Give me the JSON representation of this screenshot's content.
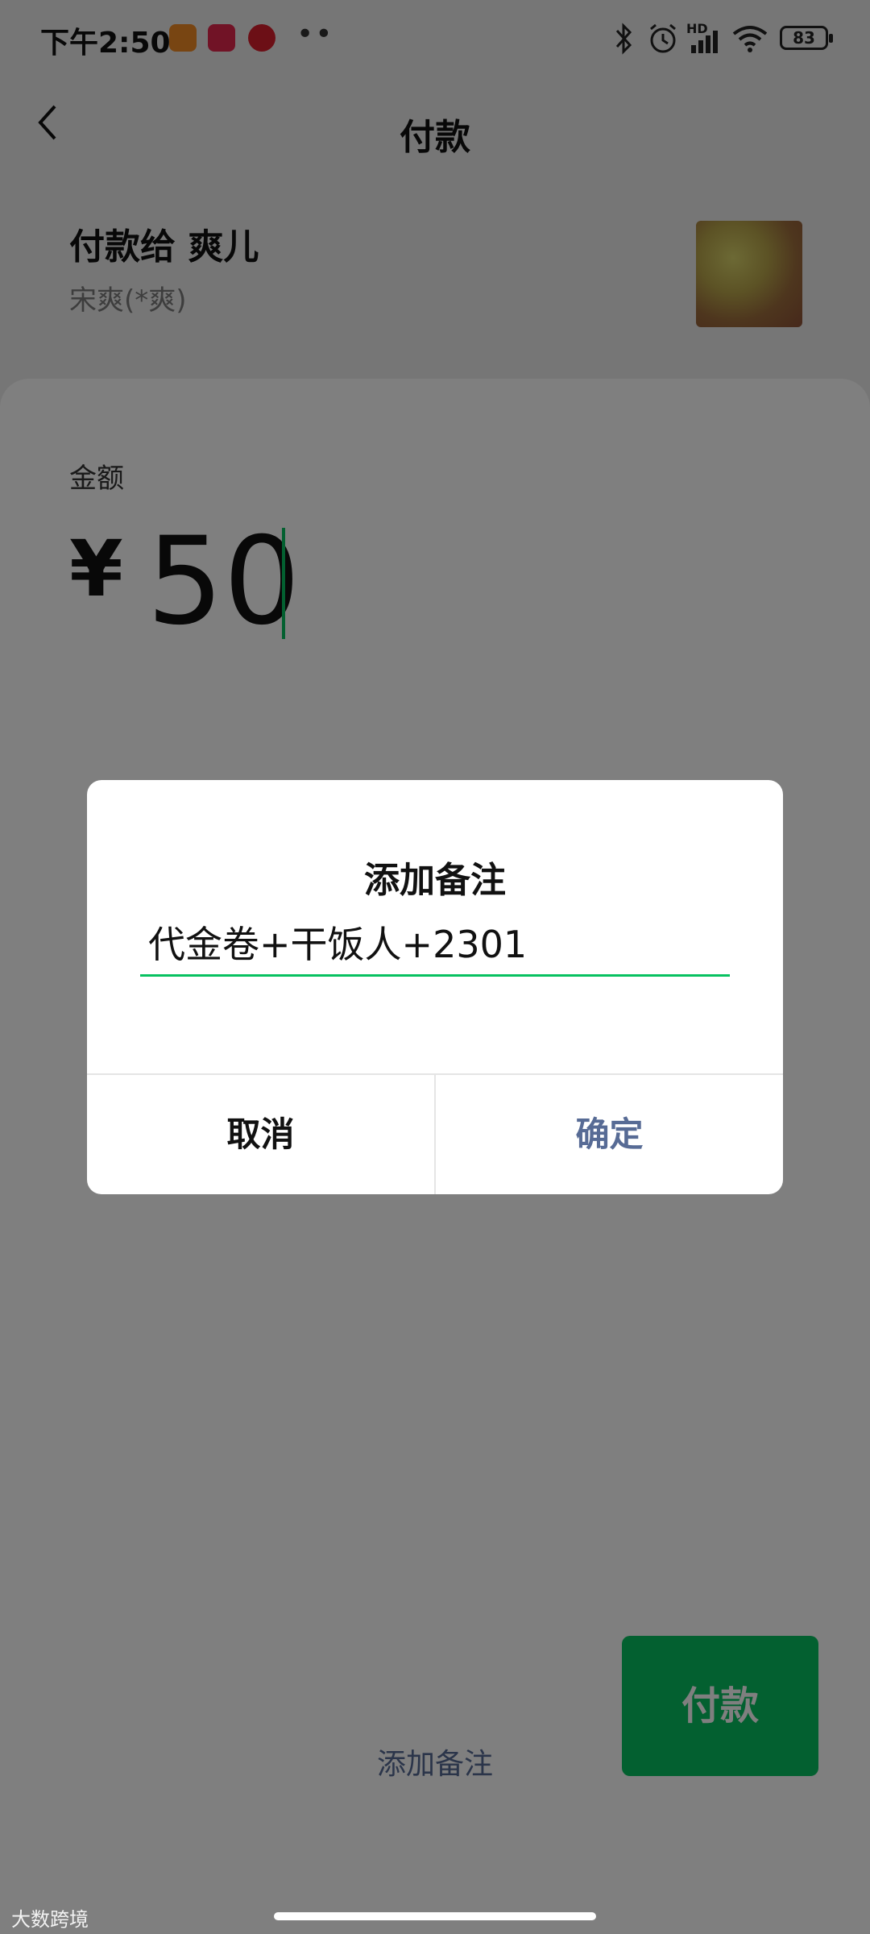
{
  "status_bar": {
    "time": "下午2:50",
    "dots": "••",
    "battery": "83",
    "hd": "HD"
  },
  "header": {
    "title": "付款"
  },
  "payee": {
    "name": "付款给 爽儿",
    "real_name": "宋爽(*爽)"
  },
  "amount": {
    "label": "金额",
    "currency": "¥",
    "value": "50"
  },
  "bottom": {
    "add_note": "添加备注",
    "pay_label": "付款"
  },
  "dialog": {
    "title": "添加备注",
    "input_value": "代金卷+干饭人+2301",
    "cancel_label": "取消",
    "confirm_label": "确定"
  },
  "watermark": "大数跨境",
  "colors": {
    "accent_green": "#07c160",
    "link_blue": "#576b95"
  }
}
